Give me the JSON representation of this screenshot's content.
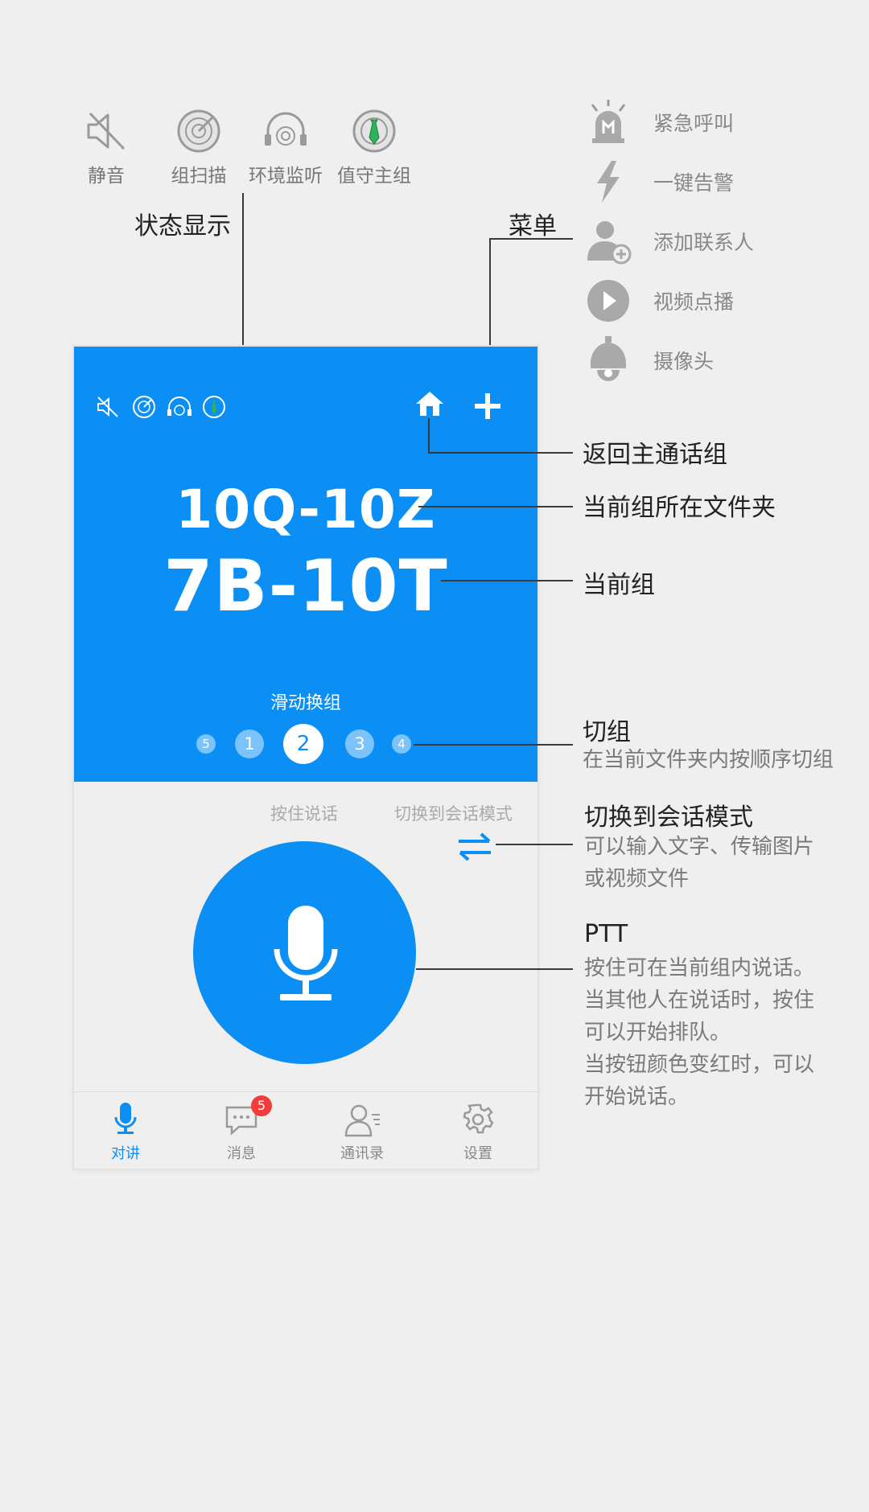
{
  "legend": {
    "status_icons": [
      {
        "label": "静音",
        "icon": "mute-icon"
      },
      {
        "label": "组扫描",
        "icon": "group-scan-icon"
      },
      {
        "label": "环境监听",
        "icon": "ambient-monitor-icon"
      },
      {
        "label": "值守主组",
        "icon": "standby-main-group-icon"
      }
    ],
    "status_label": "状态显示",
    "menu_label": "菜单",
    "menu_items": [
      {
        "label": "紧急呼叫",
        "icon": "emergency-call-icon"
      },
      {
        "label": "一键告警",
        "icon": "one-key-alarm-icon"
      },
      {
        "label": "添加联系人",
        "icon": "add-contact-icon"
      },
      {
        "label": "视频点播",
        "icon": "video-on-demand-icon"
      },
      {
        "label": "摄像头",
        "icon": "camera-icon"
      }
    ]
  },
  "annotations": {
    "home_group": "返回主通话组",
    "folder": "当前组所在文件夹",
    "current_group": "当前组",
    "switch_group_title": "切组",
    "switch_group_desc": "在当前文件夹内按顺序切组",
    "session_mode_title": "切换到会话模式",
    "session_mode_desc_1": "可以输入文字、传输图片",
    "session_mode_desc_2": "或视频文件",
    "ptt_title": "PTT",
    "ptt_desc_1": "按住可在当前组内说话。",
    "ptt_desc_2": "当其他人在说话时，按住",
    "ptt_desc_3": "可以开始排队。",
    "ptt_desc_4": "当按钮颜色变红时，可以",
    "ptt_desc_5": "开始说话。"
  },
  "phone": {
    "folder_name": "10Q-10Z",
    "group_name": "7B-10T",
    "slide_hint": "滑动换组",
    "group_dots": [
      "5",
      "1",
      "2",
      "3",
      "4"
    ],
    "active_dot": "2",
    "hold_to_talk": "按住说话",
    "switch_session": "切换到会话模式",
    "tabs": [
      {
        "label": "对讲",
        "icon": "microphone-icon",
        "active": true
      },
      {
        "label": "消息",
        "icon": "message-icon",
        "badge": "5"
      },
      {
        "label": "通讯录",
        "icon": "contacts-icon"
      },
      {
        "label": "设置",
        "icon": "settings-icon"
      }
    ]
  },
  "colors": {
    "primary": "#0b8ff4",
    "dot_inactive": "#7bc3fa",
    "badge": "#f23b3b",
    "background": "#efefef"
  }
}
